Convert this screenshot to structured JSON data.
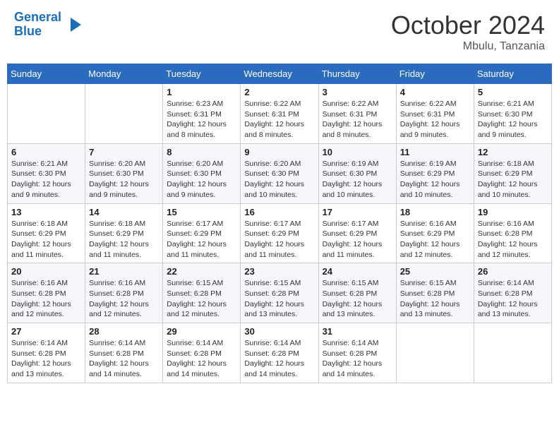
{
  "header": {
    "logo_line1": "General",
    "logo_line2": "Blue",
    "month": "October 2024",
    "location": "Mbulu, Tanzania"
  },
  "weekdays": [
    "Sunday",
    "Monday",
    "Tuesday",
    "Wednesday",
    "Thursday",
    "Friday",
    "Saturday"
  ],
  "weeks": [
    [
      {
        "day": "",
        "info": ""
      },
      {
        "day": "",
        "info": ""
      },
      {
        "day": "1",
        "info": "Sunrise: 6:23 AM\nSunset: 6:31 PM\nDaylight: 12 hours\nand 8 minutes."
      },
      {
        "day": "2",
        "info": "Sunrise: 6:22 AM\nSunset: 6:31 PM\nDaylight: 12 hours\nand 8 minutes."
      },
      {
        "day": "3",
        "info": "Sunrise: 6:22 AM\nSunset: 6:31 PM\nDaylight: 12 hours\nand 8 minutes."
      },
      {
        "day": "4",
        "info": "Sunrise: 6:22 AM\nSunset: 6:31 PM\nDaylight: 12 hours\nand 9 minutes."
      },
      {
        "day": "5",
        "info": "Sunrise: 6:21 AM\nSunset: 6:30 PM\nDaylight: 12 hours\nand 9 minutes."
      }
    ],
    [
      {
        "day": "6",
        "info": "Sunrise: 6:21 AM\nSunset: 6:30 PM\nDaylight: 12 hours\nand 9 minutes."
      },
      {
        "day": "7",
        "info": "Sunrise: 6:20 AM\nSunset: 6:30 PM\nDaylight: 12 hours\nand 9 minutes."
      },
      {
        "day": "8",
        "info": "Sunrise: 6:20 AM\nSunset: 6:30 PM\nDaylight: 12 hours\nand 9 minutes."
      },
      {
        "day": "9",
        "info": "Sunrise: 6:20 AM\nSunset: 6:30 PM\nDaylight: 12 hours\nand 10 minutes."
      },
      {
        "day": "10",
        "info": "Sunrise: 6:19 AM\nSunset: 6:30 PM\nDaylight: 12 hours\nand 10 minutes."
      },
      {
        "day": "11",
        "info": "Sunrise: 6:19 AM\nSunset: 6:29 PM\nDaylight: 12 hours\nand 10 minutes."
      },
      {
        "day": "12",
        "info": "Sunrise: 6:18 AM\nSunset: 6:29 PM\nDaylight: 12 hours\nand 10 minutes."
      }
    ],
    [
      {
        "day": "13",
        "info": "Sunrise: 6:18 AM\nSunset: 6:29 PM\nDaylight: 12 hours\nand 11 minutes."
      },
      {
        "day": "14",
        "info": "Sunrise: 6:18 AM\nSunset: 6:29 PM\nDaylight: 12 hours\nand 11 minutes."
      },
      {
        "day": "15",
        "info": "Sunrise: 6:17 AM\nSunset: 6:29 PM\nDaylight: 12 hours\nand 11 minutes."
      },
      {
        "day": "16",
        "info": "Sunrise: 6:17 AM\nSunset: 6:29 PM\nDaylight: 12 hours\nand 11 minutes."
      },
      {
        "day": "17",
        "info": "Sunrise: 6:17 AM\nSunset: 6:29 PM\nDaylight: 12 hours\nand 11 minutes."
      },
      {
        "day": "18",
        "info": "Sunrise: 6:16 AM\nSunset: 6:29 PM\nDaylight: 12 hours\nand 12 minutes."
      },
      {
        "day": "19",
        "info": "Sunrise: 6:16 AM\nSunset: 6:28 PM\nDaylight: 12 hours\nand 12 minutes."
      }
    ],
    [
      {
        "day": "20",
        "info": "Sunrise: 6:16 AM\nSunset: 6:28 PM\nDaylight: 12 hours\nand 12 minutes."
      },
      {
        "day": "21",
        "info": "Sunrise: 6:16 AM\nSunset: 6:28 PM\nDaylight: 12 hours\nand 12 minutes."
      },
      {
        "day": "22",
        "info": "Sunrise: 6:15 AM\nSunset: 6:28 PM\nDaylight: 12 hours\nand 12 minutes."
      },
      {
        "day": "23",
        "info": "Sunrise: 6:15 AM\nSunset: 6:28 PM\nDaylight: 12 hours\nand 13 minutes."
      },
      {
        "day": "24",
        "info": "Sunrise: 6:15 AM\nSunset: 6:28 PM\nDaylight: 12 hours\nand 13 minutes."
      },
      {
        "day": "25",
        "info": "Sunrise: 6:15 AM\nSunset: 6:28 PM\nDaylight: 12 hours\nand 13 minutes."
      },
      {
        "day": "26",
        "info": "Sunrise: 6:14 AM\nSunset: 6:28 PM\nDaylight: 12 hours\nand 13 minutes."
      }
    ],
    [
      {
        "day": "27",
        "info": "Sunrise: 6:14 AM\nSunset: 6:28 PM\nDaylight: 12 hours\nand 13 minutes."
      },
      {
        "day": "28",
        "info": "Sunrise: 6:14 AM\nSunset: 6:28 PM\nDaylight: 12 hours\nand 14 minutes."
      },
      {
        "day": "29",
        "info": "Sunrise: 6:14 AM\nSunset: 6:28 PM\nDaylight: 12 hours\nand 14 minutes."
      },
      {
        "day": "30",
        "info": "Sunrise: 6:14 AM\nSunset: 6:28 PM\nDaylight: 12 hours\nand 14 minutes."
      },
      {
        "day": "31",
        "info": "Sunrise: 6:14 AM\nSunset: 6:28 PM\nDaylight: 12 hours\nand 14 minutes."
      },
      {
        "day": "",
        "info": ""
      },
      {
        "day": "",
        "info": ""
      }
    ]
  ]
}
